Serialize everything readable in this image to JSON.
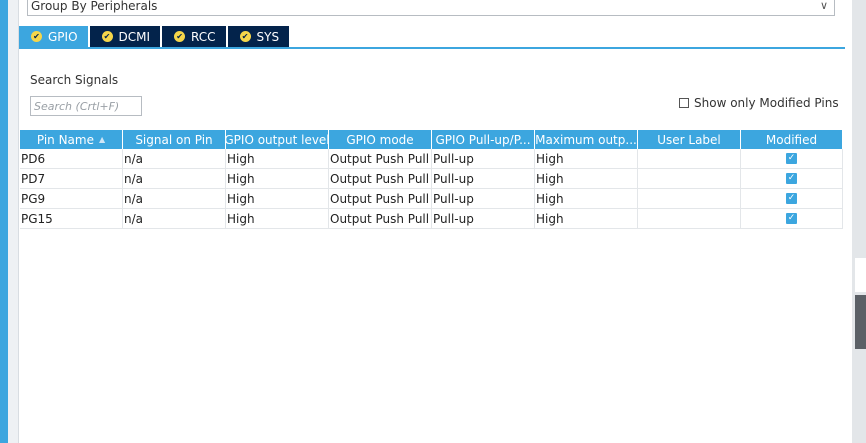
{
  "group_select": {
    "value": "Group By Peripherals"
  },
  "tabs": [
    {
      "label": "GPIO",
      "active": true
    },
    {
      "label": "DCMI",
      "active": false
    },
    {
      "label": "RCC",
      "active": false
    },
    {
      "label": "SYS",
      "active": false
    }
  ],
  "search": {
    "label": "Search Signals",
    "placeholder": "Search (Crtl+F)"
  },
  "show_modified": {
    "label": "Show only Modified Pins",
    "checked": false
  },
  "table": {
    "columns": [
      "Pin Name",
      "Signal on Pin",
      "GPIO output level",
      "GPIO mode",
      "GPIO Pull-up/P...",
      "Maximum outp...",
      "User Label",
      "Modified"
    ],
    "rows": [
      {
        "pin": "PD6",
        "signal": "n/a",
        "level": "High",
        "mode": "Output Push Pull",
        "pull": "Pull-up",
        "speed": "High",
        "label": "",
        "modified": true
      },
      {
        "pin": "PD7",
        "signal": "n/a",
        "level": "High",
        "mode": "Output Push Pull",
        "pull": "Pull-up",
        "speed": "High",
        "label": "",
        "modified": true
      },
      {
        "pin": "PG9",
        "signal": "n/a",
        "level": "High",
        "mode": "Output Push Pull",
        "pull": "Pull-up",
        "speed": "High",
        "label": "",
        "modified": true
      },
      {
        "pin": "PG15",
        "signal": "n/a",
        "level": "High",
        "mode": "Output Push Pull",
        "pull": "Pull-up",
        "speed": "High",
        "label": "",
        "modified": true
      }
    ]
  },
  "colors": {
    "accent": "#3ca6df",
    "tab_dark": "#03234b",
    "tab_icon": "#f5d64a"
  },
  "icons": {
    "tab_status": "check-circle-icon",
    "sort": "sort-up-icon",
    "dropdown": "chevron-down-icon",
    "modified": "checkbox-checked-icon"
  }
}
